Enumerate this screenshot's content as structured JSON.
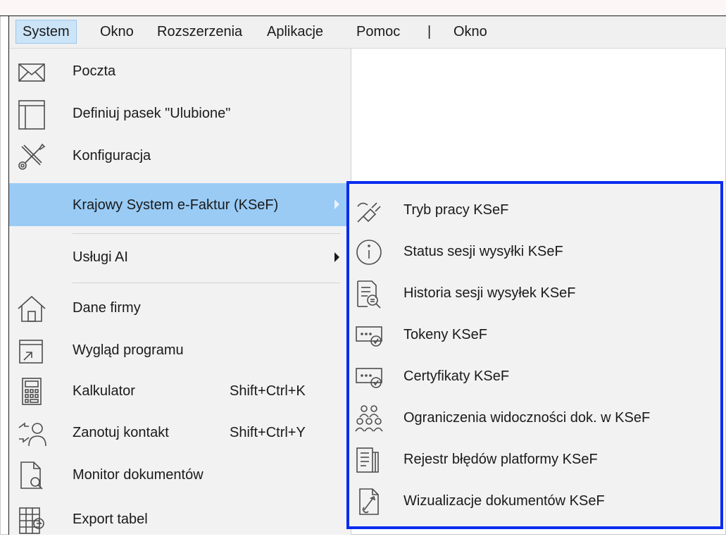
{
  "menubar": {
    "items": [
      "System",
      "Okno",
      "Rozszerzenia",
      "Aplikacje",
      "Pomoc",
      "|",
      "Okno"
    ]
  },
  "system_menu": {
    "items": [
      {
        "label": "Poczta",
        "icon": "envelope-icon"
      },
      {
        "label": "Definiuj pasek \"Ulubione\"",
        "icon": "panel-icon"
      },
      {
        "label": "Konfiguracja",
        "icon": "wrench-screwdriver-icon"
      },
      {
        "label": "Krajowy System e-Faktur (KSeF)",
        "icon": "none",
        "submenu": true,
        "highlighted": true
      },
      {
        "label": "Usługi AI",
        "icon": "none",
        "submenu": true
      },
      {
        "label": "Dane firmy",
        "icon": "house-icon"
      },
      {
        "label": "Wygląd programu",
        "icon": "window-icon"
      },
      {
        "label": "Kalkulator",
        "shortcut": "Shift+Ctrl+K",
        "icon": "calculator-icon"
      },
      {
        "label": "Zanotuj kontakt",
        "shortcut": "Shift+Ctrl+Y",
        "icon": "contact-icon"
      },
      {
        "label": "Monitor dokumentów",
        "icon": "document-search-icon"
      },
      {
        "label": "Export tabel",
        "icon": "table-export-icon"
      }
    ]
  },
  "ksef_submenu": {
    "items": [
      {
        "label": "Tryb pracy KSeF",
        "icon": "plug-icon"
      },
      {
        "label": "Status sesji wysyłki KSeF",
        "icon": "info-icon"
      },
      {
        "label": "Historia sesji wysyłek KSeF",
        "icon": "history-document-icon"
      },
      {
        "label": "Tokeny KSeF",
        "icon": "token-icon"
      },
      {
        "label": "Certyfikaty KSeF",
        "icon": "certificate-icon"
      },
      {
        "label": "Ograniczenia widoczności dok. w KSeF",
        "icon": "users-group-icon"
      },
      {
        "label": "Rejestr błędów platformy KSeF",
        "icon": "error-register-icon"
      },
      {
        "label": "Wizualizacje dokumentów KSeF",
        "icon": "visualization-document-icon"
      }
    ]
  },
  "colors": {
    "highlight": "#99cbf5",
    "submenu_border": "#0a2cf0",
    "menu_bg": "#f2f2f2"
  }
}
